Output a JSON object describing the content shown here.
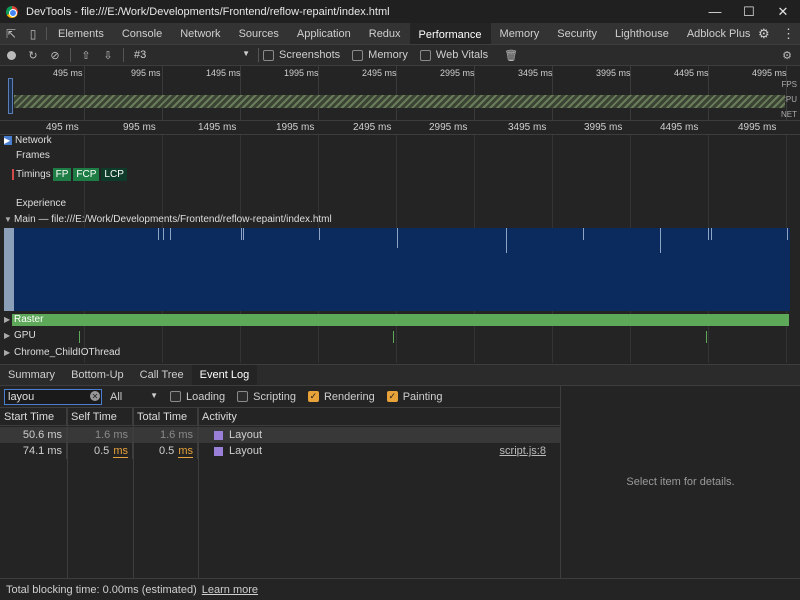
{
  "window": {
    "title": "DevTools - file:///E:/Work/Developments/Frontend/reflow-repaint/index.html"
  },
  "tabs": [
    "Elements",
    "Console",
    "Network",
    "Sources",
    "Application",
    "Redux",
    "Performance",
    "Memory",
    "Security",
    "Lighthouse",
    "Adblock Plus"
  ],
  "active_tab": "Performance",
  "toolbar": {
    "profile_select": "#3",
    "screenshots_label": "Screenshots",
    "memory_label": "Memory",
    "web_vitals_label": "Web Vitals"
  },
  "overview": {
    "ticks": [
      "495 ms",
      "995 ms",
      "1495 ms",
      "1995 ms",
      "2495 ms",
      "2995 ms",
      "3495 ms",
      "3995 ms",
      "4495 ms",
      "4995 ms"
    ],
    "labels": {
      "fps": "FPS",
      "cpu": "CPU",
      "net": "NET"
    }
  },
  "timeline": {
    "ticks": [
      "495 ms",
      "995 ms",
      "1495 ms",
      "1995 ms",
      "2495 ms",
      "2995 ms",
      "3495 ms",
      "3995 ms",
      "4495 ms",
      "4995 ms"
    ],
    "tracks": {
      "network": "Network",
      "frames": "Frames",
      "timings": "Timings",
      "fp": "FP",
      "fcp": "FCP",
      "lcp": "LCP",
      "experience": "Experience",
      "main": "Main — file:///E:/Work/Developments/Frontend/reflow-repaint/index.html",
      "raster": "Raster",
      "gpu": "GPU",
      "child_io": "Chrome_ChildIOThread"
    }
  },
  "bottom_tabs": [
    "Summary",
    "Bottom-Up",
    "Call Tree",
    "Event Log"
  ],
  "active_bottom_tab": "Event Log",
  "filter": {
    "search_value": "layou",
    "category_select": "All",
    "loading_label": "Loading",
    "scripting_label": "Scripting",
    "rendering_label": "Rendering",
    "painting_label": "Painting",
    "loading_checked": false,
    "scripting_checked": false,
    "rendering_checked": true,
    "painting_checked": true
  },
  "event_log": {
    "columns": {
      "start": "Start Time",
      "self": "Self Time",
      "total": "Total Time",
      "activity": "Activity"
    },
    "rows": [
      {
        "start": "50.6 ms",
        "self": "1.6 ms",
        "total": "1.6 ms",
        "activity": "Layout",
        "link": ""
      },
      {
        "start": "74.1 ms",
        "self_num": "0.5",
        "self_unit": "ms",
        "total_num": "0.5",
        "total_unit": "ms",
        "activity": "Layout",
        "link": "script.js:8"
      }
    ]
  },
  "details": {
    "placeholder": "Select item for details."
  },
  "footer": {
    "text": "Total blocking time: 0.00ms (estimated)",
    "link": "Learn more"
  },
  "colors": {
    "main_track": "#0b2a5e",
    "raster": "#5ea85a",
    "layout": "#9a7fd8",
    "accent": "#e8a23a"
  }
}
